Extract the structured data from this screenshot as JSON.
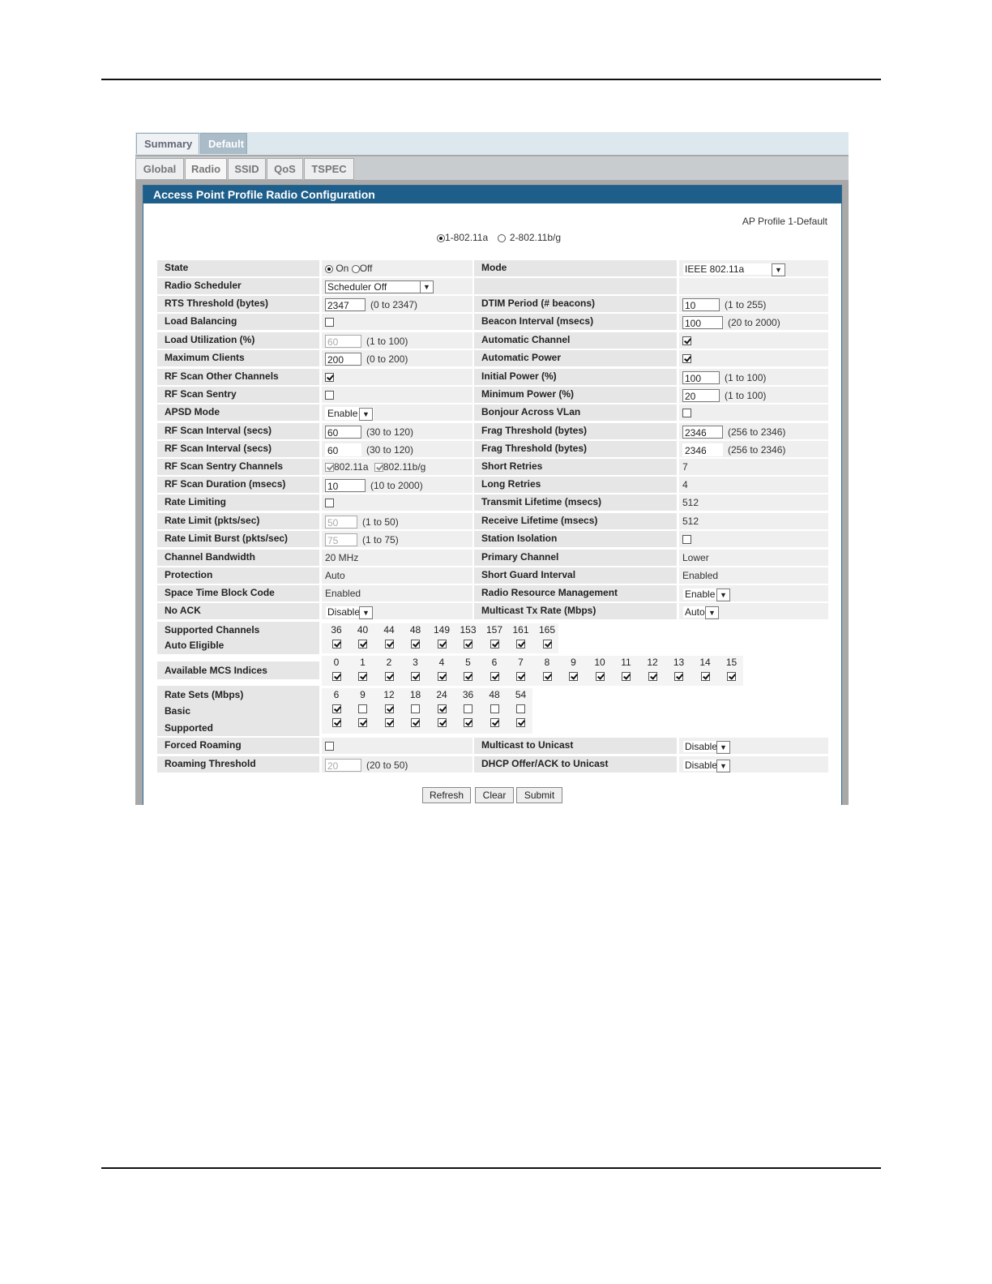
{
  "tabs_top": [
    {
      "label": "Summary"
    },
    {
      "label": "Default"
    }
  ],
  "tabs_sub": [
    {
      "label": "Global"
    },
    {
      "label": "Radio"
    },
    {
      "label": "SSID"
    },
    {
      "label": "QoS"
    },
    {
      "label": "TSPEC"
    }
  ],
  "panel": {
    "title": "Access Point Profile Radio Configuration",
    "ap_profile": "AP Profile 1-Default",
    "radio_options": [
      "1-802.11a",
      "2-802.11b/g"
    ]
  },
  "left": {
    "state": {
      "label": "State",
      "on": "On",
      "off": "Off"
    },
    "radio_scheduler": {
      "label": "Radio Scheduler",
      "value": "Scheduler Off"
    },
    "rts": {
      "label": "RTS Threshold (bytes)",
      "value": "2347",
      "range": "(0 to 2347)"
    },
    "load_balancing": {
      "label": "Load Balancing"
    },
    "load_util": {
      "label": "Load Utilization (%)",
      "value": "60",
      "range": "(1 to 100)"
    },
    "max_clients": {
      "label": "Maximum Clients",
      "value": "200",
      "range": "(0 to 200)"
    },
    "rf_scan_other": {
      "label": "RF Scan Other Channels"
    },
    "rf_scan_sentry": {
      "label": "RF Scan Sentry"
    },
    "apsd": {
      "label": "APSD Mode",
      "value": "Enable"
    },
    "rf_scan_interval": {
      "label": "RF Scan Interval (secs)",
      "value": "60",
      "range": "(30 to 120)"
    },
    "rf_scan_interval2": {
      "label": "RF Scan Interval (secs)",
      "value": "60",
      "range": "(30 to 120)"
    },
    "rf_sentry_channels": {
      "label": "RF Scan Sentry Channels",
      "opt1": "802.11a",
      "opt2": "802.11b/g"
    },
    "rf_scan_duration": {
      "label": "RF Scan Duration (msecs)",
      "value": "10",
      "range": "(10 to 2000)"
    },
    "rate_limiting": {
      "label": "Rate Limiting"
    },
    "rate_limit": {
      "label": "Rate Limit (pkts/sec)",
      "value": "50",
      "range": "(1 to 50)"
    },
    "rate_burst": {
      "label": "Rate Limit Burst (pkts/sec)",
      "value": "75",
      "range": "(1 to 75)"
    },
    "channel_bw": {
      "label": "Channel Bandwidth",
      "value": "20 MHz"
    },
    "protection": {
      "label": "Protection",
      "value": "Auto"
    },
    "stbc": {
      "label": "Space Time Block Code",
      "value": "Enabled"
    },
    "no_ack": {
      "label": "No ACK",
      "value": "Disable"
    },
    "forced_roaming": {
      "label": "Forced Roaming"
    },
    "roaming_threshold": {
      "label": "Roaming Threshold",
      "value": "20",
      "range": "(20 to 50)"
    }
  },
  "right": {
    "mode": {
      "label": "Mode",
      "value": "IEEE 802.11a"
    },
    "dtim": {
      "label": "DTIM Period (# beacons)",
      "value": "10",
      "range": "(1 to 255)"
    },
    "beacon": {
      "label": "Beacon Interval (msecs)",
      "value": "100",
      "range": "(20 to 2000)"
    },
    "auto_channel": {
      "label": "Automatic Channel"
    },
    "auto_power": {
      "label": "Automatic Power"
    },
    "initial_power": {
      "label": "Initial Power (%)",
      "value": "100",
      "range": "(1 to 100)"
    },
    "min_power": {
      "label": "Minimum Power (%)",
      "value": "20",
      "range": "(1 to 100)"
    },
    "bonjour": {
      "label": "Bonjour Across VLan"
    },
    "frag": {
      "label": "Frag Threshold (bytes)",
      "value": "2346",
      "range": "(256 to 2346)"
    },
    "frag2": {
      "label": "Frag Threshold (bytes)",
      "value": "2346",
      "range": "(256 to 2346)"
    },
    "short_retries": {
      "label": "Short Retries",
      "value": "7"
    },
    "long_retries": {
      "label": "Long Retries",
      "value": "4"
    },
    "tx_lifetime": {
      "label": "Transmit Lifetime (msecs)",
      "value": "512"
    },
    "rx_lifetime": {
      "label": "Receive Lifetime (msecs)",
      "value": "512"
    },
    "station_isolation": {
      "label": "Station Isolation"
    },
    "primary_channel": {
      "label": "Primary Channel",
      "value": "Lower"
    },
    "short_guard": {
      "label": "Short Guard Interval",
      "value": "Enabled"
    },
    "rrm": {
      "label": "Radio Resource Management",
      "value": "Enable"
    },
    "mcast_rate": {
      "label": "Multicast Tx Rate (Mbps)",
      "value": "Auto"
    },
    "mcast_unicast": {
      "label": "Multicast to Unicast",
      "value": "Disable"
    },
    "dhcp_unicast": {
      "label": "DHCP Offer/ACK to Unicast",
      "value": "Disable"
    }
  },
  "channels": {
    "label1": "Supported Channels",
    "label2": "Auto Eligible",
    "list": [
      "36",
      "40",
      "44",
      "48",
      "149",
      "153",
      "157",
      "161",
      "165"
    ]
  },
  "mcs": {
    "label": "Available MCS Indices",
    "list": [
      "0",
      "1",
      "2",
      "3",
      "4",
      "5",
      "6",
      "7",
      "8",
      "9",
      "10",
      "11",
      "12",
      "13",
      "14",
      "15"
    ]
  },
  "rates": {
    "label": "Rate Sets (Mbps)",
    "basic_label": "Basic",
    "supported_label": "Supported",
    "list": [
      "6",
      "9",
      "12",
      "18",
      "24",
      "36",
      "48",
      "54"
    ]
  },
  "buttons": {
    "refresh": "Refresh",
    "clear": "Clear",
    "submit": "Submit"
  }
}
